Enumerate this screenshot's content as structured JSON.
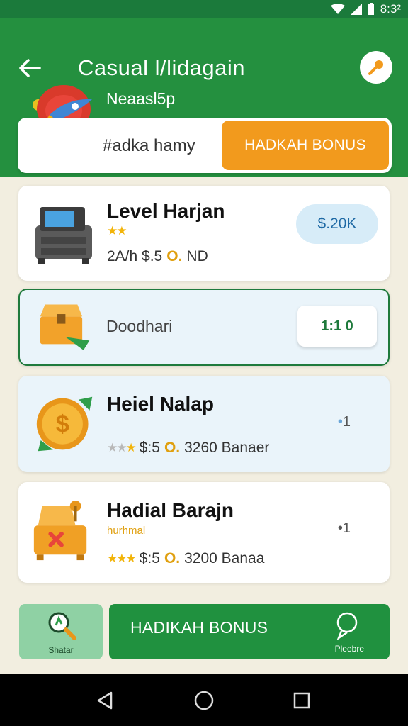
{
  "status": {
    "time": "8:3²"
  },
  "header": {
    "title": "Casual l/lidagain",
    "subtitle": "Neaasl5p",
    "bonus_bar": {
      "label": "#adka hamy",
      "button": "HADKAH BONUS"
    }
  },
  "cards": [
    {
      "title": "Level Harjan",
      "meta_left": "2А/h $.5",
      "meta_o": "O.",
      "meta_right": "ND",
      "pill": "$.20K"
    },
    {
      "label": "Doodhari",
      "button": "1:1 0"
    },
    {
      "title": "Heiel Nalap",
      "meta_left": "$:5",
      "meta_o": "O.",
      "meta_right": "3260 Banaer",
      "dot_value": "1"
    },
    {
      "title": "Hadial Barajn",
      "sub_label": "hurhmal",
      "meta_left": "$:5",
      "meta_o": "O.",
      "meta_right": "3200 Banaa",
      "dot_value": "1"
    }
  ],
  "bottom": {
    "left_label": "Shatar",
    "main_label": "HADIKAH BONUS",
    "main_sub": "Pleebre"
  },
  "colors": {
    "header_green": "#24903f",
    "accent_orange": "#f29a1d",
    "active_border": "#1f7a3c"
  }
}
